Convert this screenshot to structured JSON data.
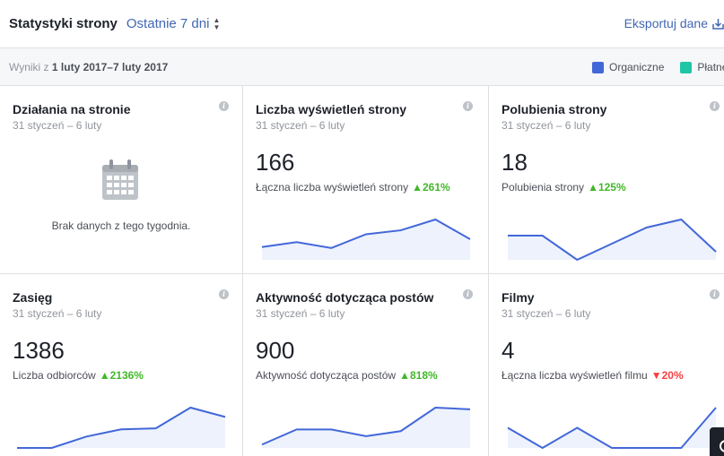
{
  "header": {
    "title": "Statystyki strony",
    "range_label": "Ostatnie 7 dni",
    "export_label": "Eksportuj dane"
  },
  "subbar": {
    "prefix": "Wyniki z",
    "range": "1 luty 2017–7 luty 2017",
    "legend": [
      {
        "label": "Organiczne",
        "color": "#4267d9"
      },
      {
        "label": "Płatne",
        "color": "#20c6a4"
      }
    ]
  },
  "cards": [
    {
      "title": "Działania na stronie",
      "date": "31 styczeń – 6 luty",
      "empty_text": "Brak danych z tego tygodnia."
    },
    {
      "title": "Liczba wyświetleń strony",
      "date": "31 styczeń – 6 luty",
      "value": "166",
      "metric": "Łączna liczba wyświetleń strony",
      "change": "261%",
      "trend": "up"
    },
    {
      "title": "Polubienia strony",
      "date": "31 styczeń – 6 luty",
      "value": "18",
      "metric": "Polubienia strony",
      "change": "125%",
      "trend": "up"
    },
    {
      "title": "Zasięg",
      "date": "31 styczeń – 6 luty",
      "value": "1386",
      "metric": "Liczba odbiorców",
      "change": "2136%",
      "trend": "up"
    },
    {
      "title": "Aktywność dotycząca postów",
      "date": "31 styczeń – 6 luty",
      "value": "900",
      "metric": "Aktywność dotycząca postów",
      "change": "818%",
      "trend": "up"
    },
    {
      "title": "Filmy",
      "date": "31 styczeń – 6 luty",
      "value": "4",
      "metric": "Łączna liczba wyświetleń filmu",
      "change": "20%",
      "trend": "down"
    }
  ],
  "chart_data": [
    {
      "type": "area",
      "card": "Liczba wyświetleń strony",
      "series": [
        {
          "values": [
            13,
            18,
            12,
            26,
            30,
            41,
            21
          ]
        }
      ]
    },
    {
      "type": "area",
      "card": "Polubienia strony",
      "series": [
        {
          "values": [
            3,
            3,
            0,
            2,
            4,
            5,
            1
          ]
        }
      ]
    },
    {
      "type": "area",
      "card": "Zasięg",
      "series": [
        {
          "values": [
            0,
            0,
            110,
            180,
            190,
            390,
            300
          ]
        }
      ]
    },
    {
      "type": "area",
      "card": "Aktywność dotycząca postów",
      "series": [
        {
          "values": [
            20,
            110,
            110,
            70,
            100,
            240,
            230
          ]
        }
      ]
    },
    {
      "type": "area",
      "card": "Filmy",
      "series": [
        {
          "values": [
            1,
            0,
            1,
            0,
            0,
            0,
            2
          ]
        }
      ]
    }
  ],
  "colors": {
    "organic": "#4267d9",
    "fill": "#edf2fc"
  },
  "icons": {
    "info": "info-icon",
    "calendar": "calendar-icon",
    "export": "download-icon",
    "caret": "sort-caret-icon"
  }
}
